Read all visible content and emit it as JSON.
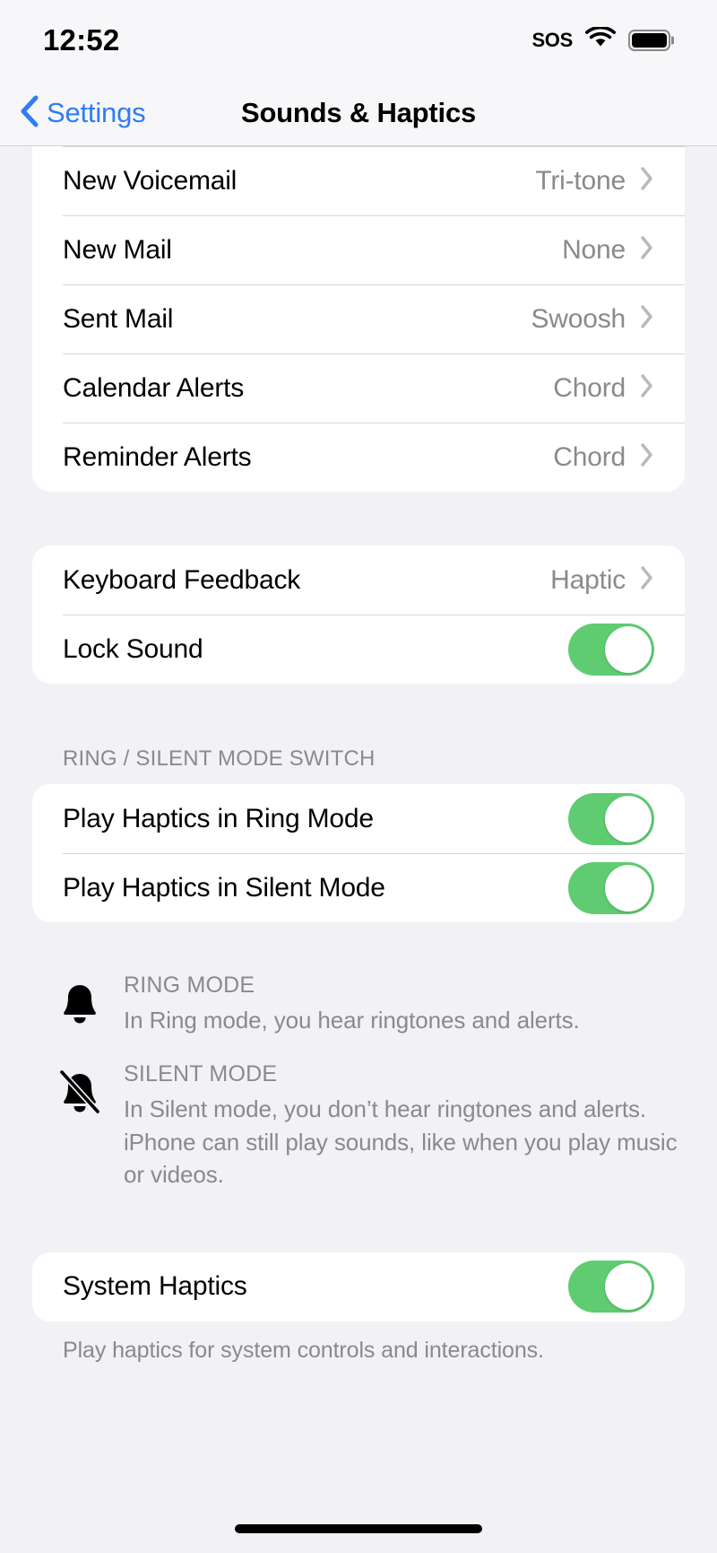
{
  "status_bar": {
    "time": "12:52",
    "sos_label": "SOS",
    "wifi_icon": "wifi-icon",
    "battery_icon": "battery-full-icon"
  },
  "nav": {
    "back_label": "Settings",
    "back_icon": "chevron-left-icon",
    "title": "Sounds & Haptics"
  },
  "alerts_group": {
    "rows": [
      {
        "label": "New Voicemail",
        "value": "Tri-tone",
        "accessory": "chevron-right-icon"
      },
      {
        "label": "New Mail",
        "value": "None",
        "accessory": "chevron-right-icon"
      },
      {
        "label": "Sent Mail",
        "value": "Swoosh",
        "accessory": "chevron-right-icon"
      },
      {
        "label": "Calendar Alerts",
        "value": "Chord",
        "accessory": "chevron-right-icon"
      },
      {
        "label": "Reminder Alerts",
        "value": "Chord",
        "accessory": "chevron-right-icon"
      }
    ]
  },
  "keyboard_group": {
    "rows": [
      {
        "label": "Keyboard Feedback",
        "value": "Haptic",
        "accessory": "chevron-right-icon"
      },
      {
        "label": "Lock Sound",
        "toggle": "on"
      }
    ]
  },
  "ring_silent_section": {
    "header": "RING / SILENT MODE SWITCH",
    "rows": [
      {
        "label": "Play Haptics in Ring Mode",
        "toggle": "on"
      },
      {
        "label": "Play Haptics in Silent Mode",
        "toggle": "on"
      }
    ],
    "explainers": [
      {
        "icon": "bell-icon",
        "title": "RING MODE",
        "description": "In Ring mode, you hear ringtones and alerts."
      },
      {
        "icon": "bell-slash-icon",
        "title": "SILENT MODE",
        "description": "In Silent mode, you don’t hear ringtones and alerts. iPhone can still play sounds, like when you play music or videos."
      }
    ]
  },
  "system_haptics_section": {
    "rows": [
      {
        "label": "System Haptics",
        "toggle": "on"
      }
    ],
    "footer": "Play haptics for system controls and interactions."
  },
  "colors": {
    "toggle_on": "#5fcc72",
    "accent_blue": "#2f7cf6",
    "page_background": "#f2f1f6",
    "group_background": "#ffffff",
    "secondary_text": "#8a8a8e"
  }
}
